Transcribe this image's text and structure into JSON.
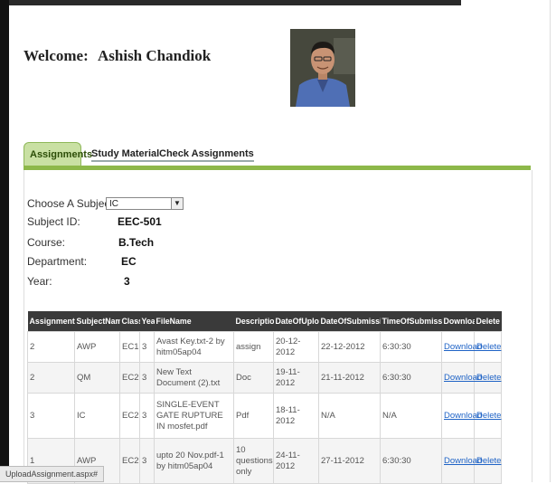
{
  "welcome": {
    "label": "Welcome:",
    "user_name": "Ashish Chandiok"
  },
  "tabs": [
    {
      "label": "Assignments",
      "active": true
    },
    {
      "label": "Study Material",
      "active": false
    },
    {
      "label": "Check Assignments",
      "active": false
    }
  ],
  "subject_form": {
    "choose_label": "Choose A Subject:",
    "selected_subject": "IC",
    "subject_id_label": "Subject ID:",
    "subject_id": "EEC-501",
    "course_label": "Course:",
    "course": "B.Tech",
    "department_label": "Department:",
    "department": "EC",
    "year_label": "Year:",
    "year": "3"
  },
  "table": {
    "headers": [
      "AssignmentNo",
      "SubjectName",
      "Class",
      "Year",
      "FileName",
      "Description",
      "DateOfUpload",
      "DateOfSubmission",
      "TimeOfSubmission",
      "Download",
      "Delete"
    ],
    "rows": [
      {
        "no": "2",
        "subject": "AWP",
        "class": "EC1",
        "year": "3",
        "file": "Avast Key.txt-2 by hitm05ap04",
        "desc": "assign",
        "uploaded": "20-12-2012",
        "submission": "22-12-2012",
        "time": "6:30:30",
        "download": "Download",
        "delete": "Delete"
      },
      {
        "no": "2",
        "subject": "QM",
        "class": "EC2",
        "year": "3",
        "file": "New Text Document (2).txt",
        "desc": "Doc",
        "uploaded": "19-11-2012",
        "submission": "21-11-2012",
        "time": "6:30:30",
        "download": "Download",
        "delete": "Delete"
      },
      {
        "no": "3",
        "subject": "IC",
        "class": "EC2",
        "year": "3",
        "file": "SINGLE-EVENT GATE RUPTURE IN mosfet.pdf",
        "desc": "Pdf",
        "uploaded": "18-11-2012",
        "submission": "N/A",
        "time": "N/A",
        "download": "Download",
        "delete": "Delete"
      },
      {
        "no": "1",
        "subject": "AWP",
        "class": "EC2",
        "year": "3",
        "file": "upto 20 Nov.pdf-1 by hitm05ap04",
        "desc": "10 questions only",
        "uploaded": "24-11-2012",
        "submission": "27-11-2012",
        "time": "6:30:30",
        "download": "Download",
        "delete": "Delete"
      }
    ]
  },
  "status_bar": {
    "text": "UploadAssignment.aspx#"
  }
}
